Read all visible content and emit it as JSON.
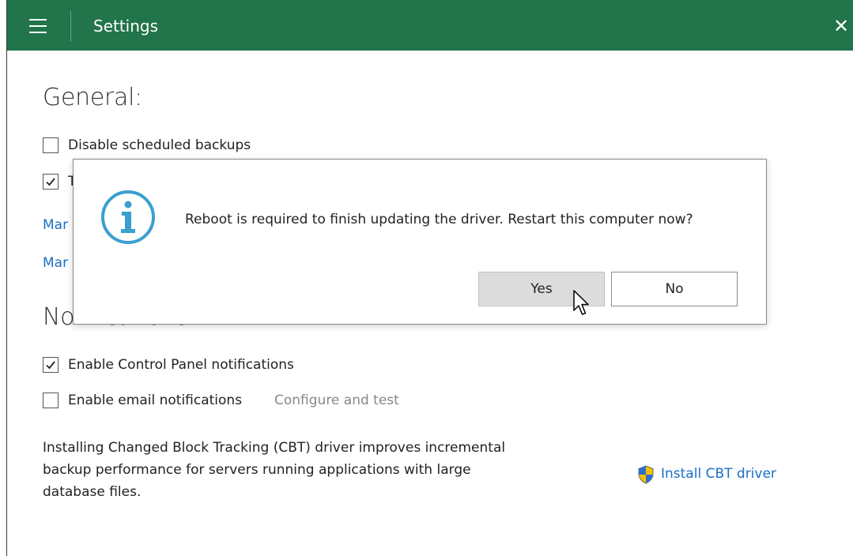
{
  "window": {
    "title": "Settings"
  },
  "general": {
    "heading": "General:",
    "disable_backups_label": "Disable scheduled backups",
    "disable_backups_checked": false,
    "second_checkbox_label": "T",
    "second_checkbox_checked": true,
    "link1": "Mar",
    "link2": "Mar"
  },
  "notifications": {
    "heading": "Notifications:",
    "control_panel_label": "Enable Control Panel notifications",
    "control_panel_checked": true,
    "email_label": "Enable email notifications",
    "email_checked": false,
    "configure_link": "Configure and test"
  },
  "cbt": {
    "description_lines": [
      "Installing Changed Block Tracking (CBT) driver improves incremental",
      "backup performance for servers running applications with large",
      "database files."
    ],
    "install_link": "Install CBT driver"
  },
  "dialog": {
    "message": "Reboot is required to finish updating the driver. Restart this computer now?",
    "yes_label": "Yes",
    "no_label": "No"
  },
  "icons": {
    "menu": "hamburger-menu-icon",
    "close": "close-icon",
    "info": "info-icon",
    "shield": "shield-icon",
    "cursor": "mouse-pointer-icon"
  },
  "colors": {
    "titlebar": "#22744a",
    "link": "#1a6fc4",
    "info_icon": "#3a9fd0"
  }
}
